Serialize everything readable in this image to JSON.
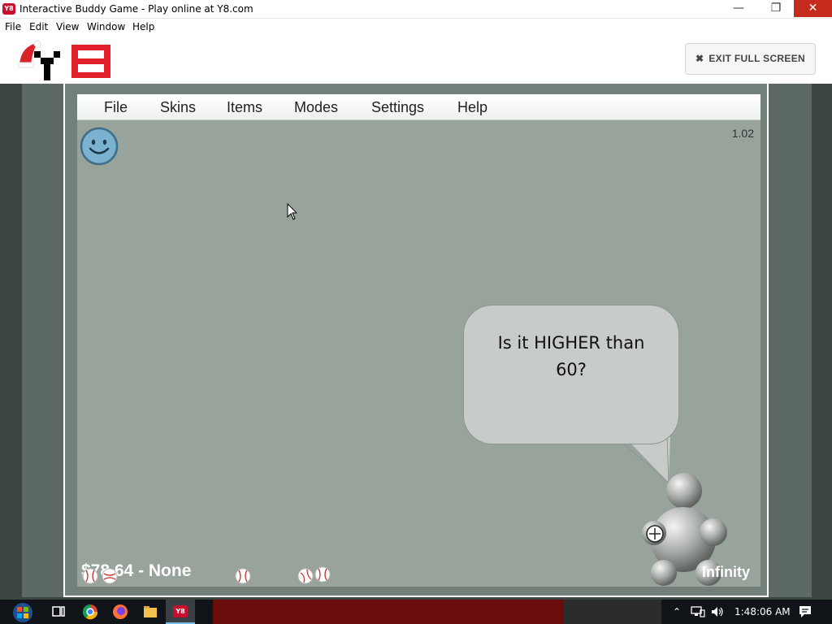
{
  "window": {
    "title": "Interactive Buddy Game - Play online at Y8.com",
    "app_icon": "Y8",
    "controls": {
      "minimize": "—",
      "maximize": "❐",
      "close": "✕"
    }
  },
  "menubar": [
    "File",
    "Edit",
    "View",
    "Window",
    "Help"
  ],
  "site": {
    "logo_icon": "y8-logo-icon",
    "exit_label": "EXIT FULL SCREEN",
    "exit_icon": "✖"
  },
  "game": {
    "menu": [
      "File",
      "Skins",
      "Items",
      "Modes",
      "Settings",
      "Help"
    ],
    "version": "1.02",
    "speech": [
      "Is it HIGHER than",
      "60?"
    ],
    "money": "$78.64  -  None",
    "mode": "Infinity",
    "mood_icon": "smiley-face-icon"
  },
  "taskbar": {
    "icons": [
      "windows-start-icon",
      "task-view-icon",
      "chrome-icon",
      "firefox-icon",
      "file-explorer-icon",
      "y8-app-icon"
    ],
    "y8_label": "Y8",
    "clock": "1:48:06 AM"
  },
  "colors": {
    "game_bg": "#98a39c",
    "close_red": "#c42b1c",
    "frame_bg": "#5d6964"
  }
}
